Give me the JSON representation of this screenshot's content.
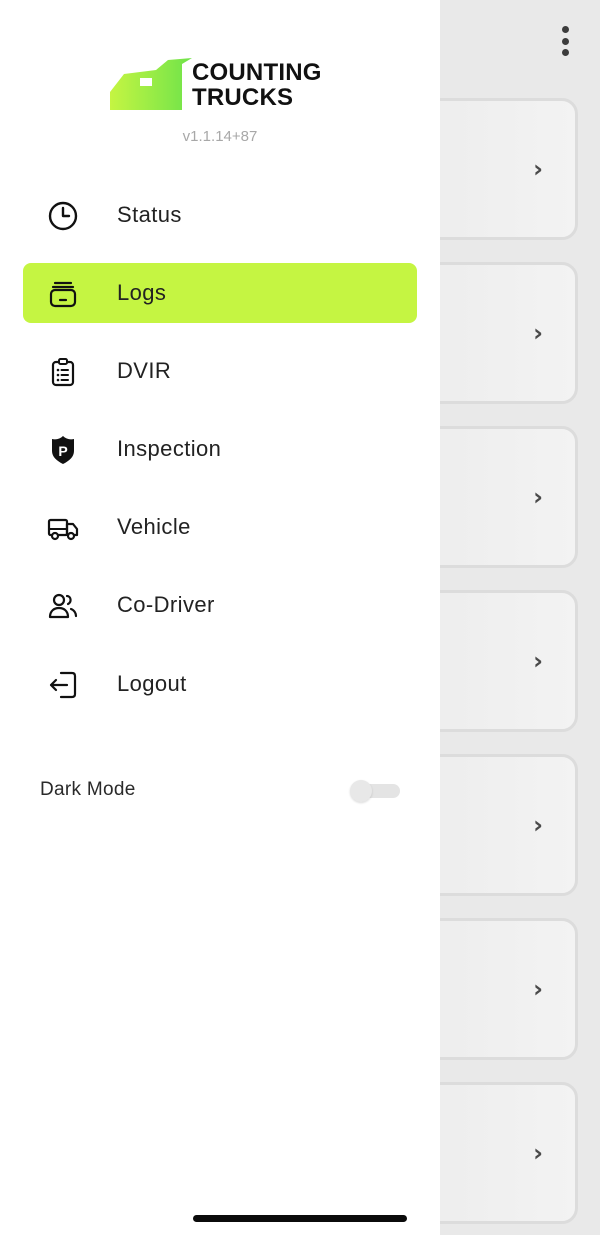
{
  "app": {
    "logo_line1": "COUNTING",
    "logo_line2": "TRUCKS",
    "version": "v1.1.14+87",
    "brand_color": "#c5f542"
  },
  "nav": {
    "items": [
      {
        "label": "Status",
        "icon": "clock-icon",
        "active": false
      },
      {
        "label": "Logs",
        "icon": "logbook-icon",
        "active": true
      },
      {
        "label": "DVIR",
        "icon": "clipboard-list-icon",
        "active": false
      },
      {
        "label": "Inspection",
        "icon": "police-badge-icon",
        "active": false
      },
      {
        "label": "Vehicle",
        "icon": "truck-icon",
        "active": false
      },
      {
        "label": "Co-Driver",
        "icon": "users-icon",
        "active": false
      },
      {
        "label": "Logout",
        "icon": "logout-icon",
        "active": false
      }
    ]
  },
  "settings": {
    "dark_mode_label": "Dark Mode",
    "dark_mode_on": false
  },
  "background": {
    "menu_icon": "more-vertical-icon",
    "cards": 7,
    "card_icon": "chevron-right-icon"
  }
}
